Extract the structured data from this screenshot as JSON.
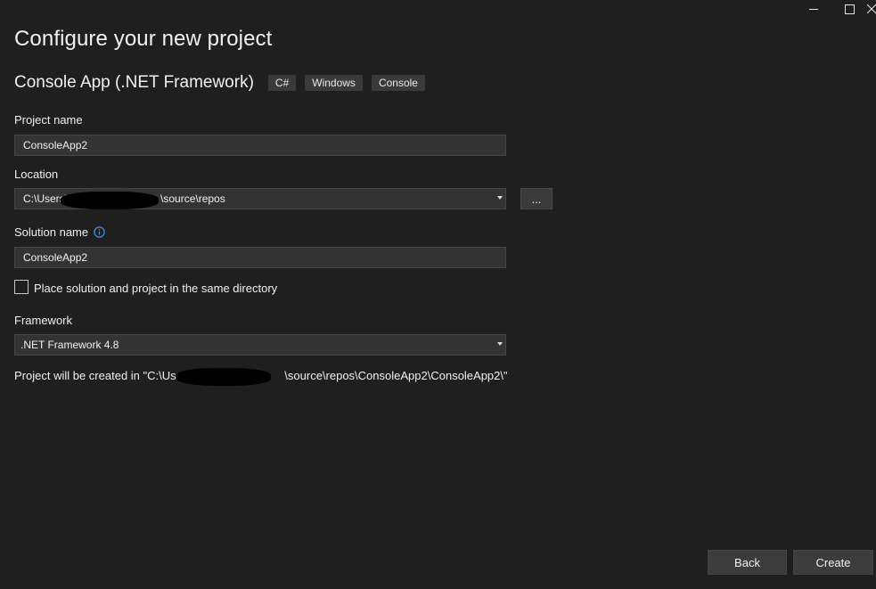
{
  "window": {
    "controls": [
      "minimize-icon",
      "maximize-icon",
      "close-icon"
    ]
  },
  "page": {
    "title": "Configure your new project"
  },
  "template": {
    "name": "Console App (.NET Framework)",
    "tags": [
      "C#",
      "Windows",
      "Console"
    ]
  },
  "form": {
    "project_name_label": "Project name",
    "project_name_value": "ConsoleApp2",
    "location_label": "Location",
    "location_value_prefix": "C:\\Users\\",
    "location_value_suffix": "\\source\\repos",
    "browse_label": "...",
    "solution_name_label": "Solution name",
    "solution_name_value": "ConsoleApp2",
    "same_dir_label": "Place solution and project in the same directory",
    "same_dir_checked": false,
    "framework_label": "Framework",
    "framework_value": ".NET Framework 4.8",
    "path_prefix": "Project will be created in \"C:\\Users\\",
    "path_suffix": "\\source\\repos\\ConsoleApp2\\ConsoleApp2\\\""
  },
  "footer": {
    "back_label": "Back",
    "create_label": "Create"
  },
  "colors": {
    "background": "#1f1f1f",
    "field": "#333333",
    "button": "#3c3c3c",
    "info_icon": "#3794ff"
  }
}
